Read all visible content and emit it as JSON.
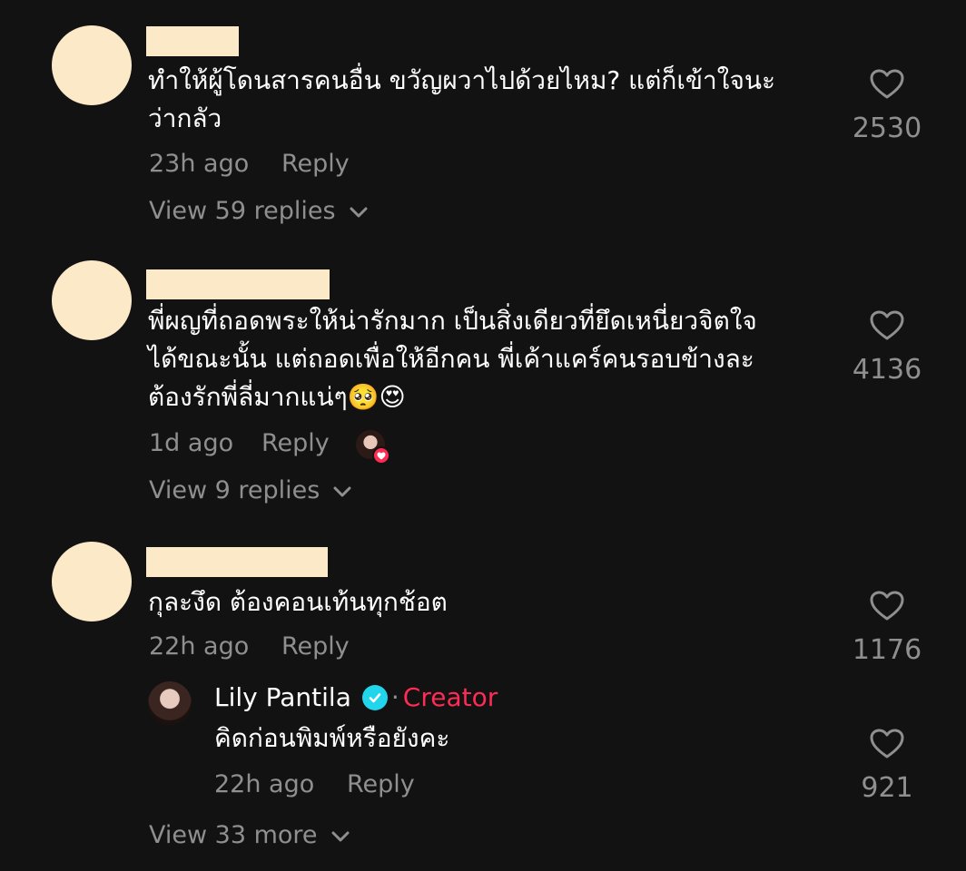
{
  "colors": {
    "background": "#121212",
    "avatar_placeholder": "#fce9c8",
    "muted": "#8f8f8f",
    "creator_accent": "#fe2c55",
    "verified": "#20d5ec"
  },
  "comments": [
    {
      "text_line1": "ทำให้ผู้โดนสารคนอื่น ขวัญผวาไปด้วยไหม? แต่ก็เข้าใจนะ",
      "text_line2": "ว่ากลัว",
      "time": "23h ago",
      "reply_label": "Reply",
      "likes": "2530",
      "view_replies": "View 59 replies"
    },
    {
      "text_line1": "พี่ผญที่ถอดพระให้น่ารักมาก เป็นสิ่งเดียวที่ยึดเหนี่ยวจิตใจ",
      "text_line2": "ได้ขณะนั้น แต่ถอดเพื่อให้อีกคน พี่เค้าแคร์คนรอบข้างละ",
      "text_line3": "ต้องรักพี่ลี่มากแน่ๆ🥺😍",
      "time": "1d ago",
      "reply_label": "Reply",
      "likes": "4136",
      "view_replies": "View 9 replies"
    },
    {
      "text_line1": "กุละงึด ต้องคอนเท้นทุกช้อต",
      "time": "22h ago",
      "reply_label": "Reply",
      "likes": "1176",
      "creator_reply": {
        "name": "Lily Pantila",
        "separator": "·",
        "badge": "Creator",
        "text": "คิดก่อนพิมพ์หรือยังคะ",
        "time": "22h ago",
        "reply_label": "Reply",
        "likes": "921"
      },
      "view_more": "View 33 more"
    }
  ]
}
